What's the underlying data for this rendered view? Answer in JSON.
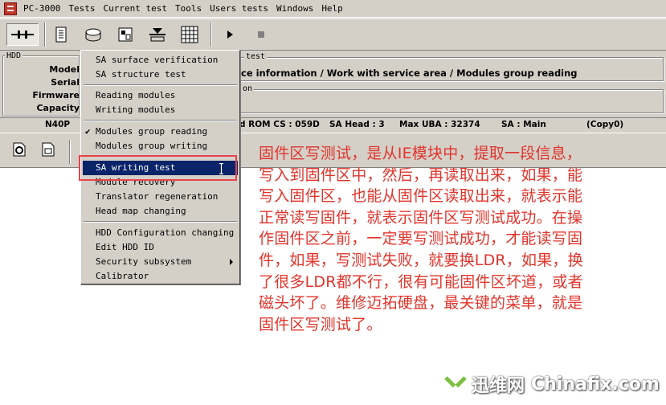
{
  "app": {
    "title": "PC-3000"
  },
  "menubar": {
    "items": [
      "PC-3000",
      "Tests",
      "Current test",
      "Tools",
      "Users tests",
      "Windows",
      "Help"
    ]
  },
  "panel": {
    "hdd_title": "HDD",
    "test_title": "test",
    "labels": [
      "Model",
      "Serial",
      "Firmware",
      "Capacity"
    ],
    "path": "ce information / Work with service area / Modules group reading",
    "sub_title": "on"
  },
  "status": {
    "model": "N40P",
    "rom_cs": "d ROM CS : 059D",
    "sa_head": "SA Head : 3",
    "max_uba": "Max UBA : 32374",
    "sa": "SA : Main",
    "copy": "(Copy0)"
  },
  "dropdown": {
    "items": [
      {
        "label": "SA surface verification",
        "checked": false
      },
      {
        "label": "SA structure test",
        "checked": false
      },
      {
        "label": "Reading modules",
        "checked": false
      },
      {
        "label": "Writing modules",
        "checked": false
      },
      {
        "label": "Modules group reading",
        "checked": true
      },
      {
        "label": "Modules group writing",
        "checked": false
      },
      {
        "label": "SA writing test",
        "checked": false,
        "selected": true
      },
      {
        "label": "Module recovery",
        "checked": false
      },
      {
        "label": "Translator regeneration",
        "checked": false
      },
      {
        "label": "Head map changing",
        "checked": false
      },
      {
        "label": "HDD Configuration changing",
        "checked": false
      },
      {
        "label": "Edit HDD ID",
        "checked": false
      },
      {
        "label": "Security subsystem",
        "checked": false,
        "submenu": true
      },
      {
        "label": "Calibrator",
        "checked": false
      }
    ]
  },
  "annotation": {
    "lines": [
      "固件区写测试，是从IE模块中，提取一段信息，",
      "写入到固件区中，然后，再读取出来，如果，能",
      "写入固件区，也能从固件区读取出来，就表示能",
      "正常读写固件，就表示固件区写测试成功。在操",
      "作固件区之前，一定要写测试成功，才能读写固",
      "件，如果，写测试失败，就要换LDR，如果，换",
      "了很多LDR都不行，很有可能固件区坏道，或者",
      "磁头坏了。维修迈拓硬盘，最关键的菜单，就是",
      "固件区写测试了。"
    ],
    "color": "#e2342b"
  },
  "watermark": {
    "cn": "迅维网",
    "en": "Chinafix.com"
  },
  "icons": [
    "app-icon",
    "connect-icon",
    "scroll-icon",
    "disk-icon",
    "module-icon",
    "tape-icon",
    "grid-icon",
    "play-icon",
    "stop-icon",
    "gear-doc-icon",
    "drive-doc-icon"
  ]
}
